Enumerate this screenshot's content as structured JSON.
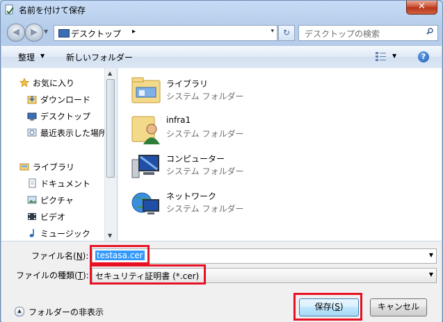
{
  "window": {
    "title": "名前を付けて保存",
    "close_symbol": "✕"
  },
  "address_bar": {
    "current_location": "デスクトップ",
    "chevron": "▸",
    "dropdown": "▾",
    "refresh_symbol": "↻"
  },
  "search": {
    "placeholder": "デスクトップの検索"
  },
  "toolbar": {
    "organize_label": "整理",
    "organize_arrow": "▼",
    "new_folder_label": "新しいフォルダー",
    "view_arrow": "▼",
    "help_symbol": "?"
  },
  "nav_pane": {
    "favorites_label": "お気に入り",
    "favorites": [
      "ダウンロード",
      "デスクトップ",
      "最近表示した場所"
    ],
    "libraries_label": "ライブラリ",
    "libraries": [
      "ドキュメント",
      "ピクチャ",
      "ビデオ",
      "ミュージック"
    ]
  },
  "items": [
    {
      "name": "ライブラリ",
      "type": "システム フォルダー",
      "icon": "library-icon"
    },
    {
      "name": "infra1",
      "type": "システム フォルダー",
      "icon": "user-folder-icon"
    },
    {
      "name": "コンピューター",
      "type": "システム フォルダー",
      "icon": "computer-icon"
    },
    {
      "name": "ネットワーク",
      "type": "システム フォルダー",
      "icon": "network-icon"
    }
  ],
  "form": {
    "filename_label_prefix": "ファイル名(",
    "filename_label_key": "N",
    "filename_label_suffix": "):",
    "filename_value": "testasa.cer",
    "filetype_label_prefix": "ファイルの種類(",
    "filetype_label_key": "T",
    "filetype_label_suffix": "):",
    "filetype_value": "セキュリティ証明書 (*.cer)",
    "dropdown_arrow": "▼"
  },
  "footer": {
    "hide_folders_label": "フォルダーの非表示",
    "hide_folders_symbol": "▲",
    "save_prefix": "保存(",
    "save_key": "S",
    "save_suffix": ")",
    "cancel_label": "キャンセル"
  },
  "colors": {
    "highlight_box": "#e81123",
    "selection": "#3399ff",
    "close_button": "#c9472b"
  }
}
